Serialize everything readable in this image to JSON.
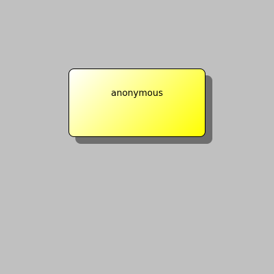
{
  "node": {
    "label": "anonymous",
    "fill_start": "#ffffff",
    "fill_end": "#ffff00",
    "border_color": "#000000",
    "shadow_color": "#6e6e6e"
  },
  "canvas": {
    "background": "#c0c0c0"
  }
}
